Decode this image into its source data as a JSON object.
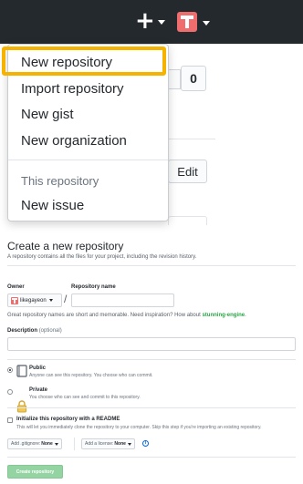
{
  "header": {
    "create_menu_glyph": "+",
    "colors": {
      "background": "#24292e",
      "avatar": "#ef6d6d"
    }
  },
  "background_page": {
    "count_value": "0",
    "edit_label": "Edit"
  },
  "create_menu": {
    "items": [
      {
        "label": "New repository",
        "highlighted": true
      },
      {
        "label": "Import repository"
      },
      {
        "label": "New gist"
      },
      {
        "label": "New organization"
      }
    ],
    "section_header": "This repository",
    "section_items": [
      {
        "label": "New issue"
      }
    ],
    "highlight_color": "#f5b300"
  },
  "form": {
    "title": "Create a new repository",
    "subtitle": "A repository contains all the files for your project, including the revision history.",
    "owner_label": "Owner",
    "owner_value": "likegayeon",
    "separator": "/",
    "repo_name_label": "Repository name",
    "repo_name_value": "",
    "hint_text": "Great repository names are short and memorable. Need inspiration? How about",
    "hint_suggestion": "stunning-engine",
    "hint_end": ".",
    "description_label": "Description",
    "description_optional": "(optional)",
    "description_value": "",
    "visibility": {
      "selected": "public",
      "public": {
        "title": "Public",
        "desc": "Anyone can see this repository. You choose who can commit."
      },
      "private": {
        "title": "Private",
        "desc": "You choose who can see and commit to this repository."
      }
    },
    "init_readme": {
      "checked": false,
      "title": "Initialize this repository with a README",
      "desc": "This will let you immediately clone the repository to your computer. Skip this step if you're importing an existing repository."
    },
    "gitignore": {
      "prefix": "Add .gitignore:",
      "value": "None"
    },
    "license": {
      "prefix": "Add a license:",
      "value": "None"
    },
    "info_glyph": "i",
    "submit_label": "Create repository",
    "submit_disabled": true,
    "colors": {
      "suggestion": "#28a745",
      "submit_bg": "#94d3a2"
    }
  }
}
